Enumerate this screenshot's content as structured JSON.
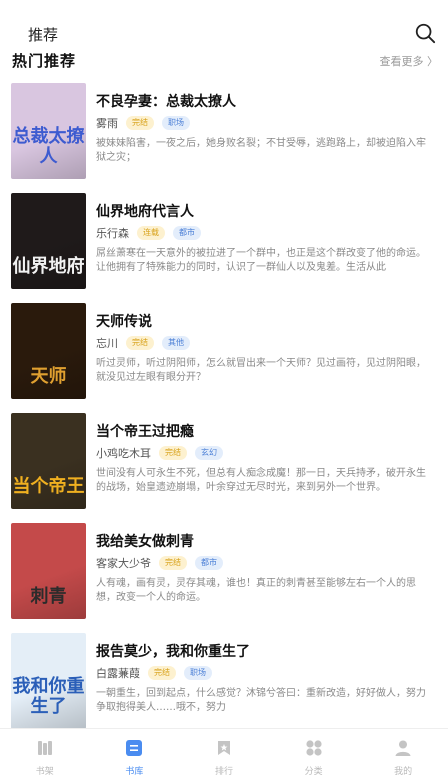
{
  "header": {
    "title": "推荐",
    "search_icon": "search-icon"
  },
  "section": {
    "title": "热门推荐",
    "more": "查看更多 〉"
  },
  "books": [
    {
      "name": "不良孕妻：总裁太撩人",
      "author": "雾雨",
      "tags": [
        {
          "text": "完结",
          "color": "yellow"
        },
        {
          "text": "职场",
          "color": "blue"
        }
      ],
      "desc": "被妹妹陷害，一夜之后，她身败名裂；不甘受辱，逃跑路上，却被迫陷入牢狱之灾；",
      "cover_text": "总裁太撩人",
      "cover_bg": "#d9c6e0",
      "cover_fg": "#3d5bd0"
    },
    {
      "name": "仙界地府代言人",
      "author": "乐行森",
      "tags": [
        {
          "text": "连载",
          "color": "yellow"
        },
        {
          "text": "都市",
          "color": "blue"
        }
      ],
      "desc": "屌丝萧寒在一天意外的被拉进了一个群中，也正是这个群改变了他的命运。让他拥有了特殊能力的同时，认识了一群仙人以及鬼差。生活从此",
      "cover_text": "仙界地府",
      "cover_bg": "#1f1a1a",
      "cover_fg": "#f2f2f2"
    },
    {
      "name": "天师传说",
      "author": "忘川",
      "tags": [
        {
          "text": "完结",
          "color": "yellow"
        },
        {
          "text": "其他",
          "color": "blue"
        }
      ],
      "desc": "听过灵师，听过阴阳师，怎么就冒出来一个天师？见过画符，见过阴阳眼，就没见过左眼有眼分开？",
      "cover_text": "天师",
      "cover_bg": "#2a1a0c",
      "cover_fg": "#e0a030"
    },
    {
      "name": "当个帝王过把瘾",
      "author": "小鸡吃木耳",
      "tags": [
        {
          "text": "完结",
          "color": "yellow"
        },
        {
          "text": "玄幻",
          "color": "blue"
        }
      ],
      "desc": "世间没有人可永生不死，但总有人痴念成魔！那一日，天兵持矛，破开永生的战场，始皇遗迹崩塌，叶余穿过无尽时光，来到另外一个世界。",
      "cover_text": "当个帝王",
      "cover_bg": "#3a3020",
      "cover_fg": "#f0b020"
    },
    {
      "name": "我给美女做刺青",
      "author": "客家大少爷",
      "tags": [
        {
          "text": "完结",
          "color": "yellow"
        },
        {
          "text": "都市",
          "color": "blue"
        }
      ],
      "desc": "人有魂，画有灵，灵存其魂，谁也！真正的刺青甚至能够左右一个人的思想，改变一个人的命运。",
      "cover_text": "刺青",
      "cover_bg": "#c44a4a",
      "cover_fg": "#2b2b2b"
    },
    {
      "name": "报告莫少，我和你重生了",
      "author": "白露蒹葭",
      "tags": [
        {
          "text": "完结",
          "color": "yellow"
        },
        {
          "text": "职场",
          "color": "blue"
        }
      ],
      "desc": "一朝重生，回到起点，什么感觉？沐锦兮答曰：重新改造，好好做人，努力争取抱得美人……哦不，努力",
      "cover_text": "我和你重生了",
      "cover_bg": "#e4eef7",
      "cover_fg": "#2b5fb8"
    }
  ],
  "tabs": [
    {
      "label": "书架",
      "icon": "bookshelf-icon",
      "active": false
    },
    {
      "label": "书库",
      "icon": "library-icon",
      "active": true
    },
    {
      "label": "排行",
      "icon": "ranking-icon",
      "active": false
    },
    {
      "label": "分类",
      "icon": "category-icon",
      "active": false
    },
    {
      "label": "我的",
      "icon": "profile-icon",
      "active": false
    }
  ],
  "colors": {
    "active_tab": "#4a8cf0",
    "inactive_tab": "#b9b9b9"
  }
}
